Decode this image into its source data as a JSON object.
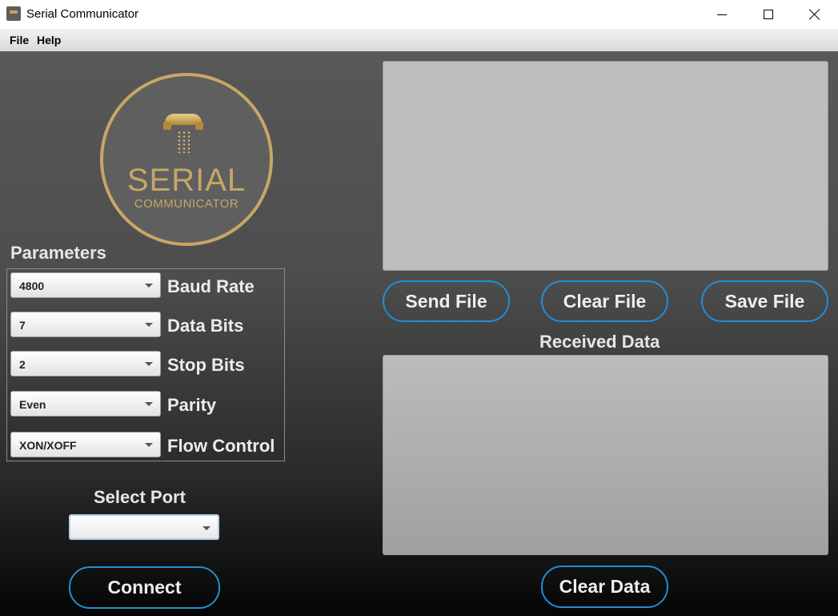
{
  "window": {
    "title": "Serial Communicator",
    "controls": [
      "minimize",
      "maximize",
      "close"
    ]
  },
  "menu": {
    "items": [
      "File",
      "Help"
    ]
  },
  "logo": {
    "line1": "SERIAL",
    "line2": "COMMUNICATOR",
    "icon": "telephone-handset-icon"
  },
  "parameters": {
    "label": "Parameters",
    "fields": [
      {
        "label": "Baud Rate",
        "value": "4800"
      },
      {
        "label": "Data Bits",
        "value": "7"
      },
      {
        "label": "Stop Bits",
        "value": "2"
      },
      {
        "label": "Parity",
        "value": "Even"
      },
      {
        "label": "Flow Control",
        "value": "XON/XOFF"
      }
    ]
  },
  "port": {
    "label": "Select Port",
    "value": ""
  },
  "buttons": {
    "connect": "Connect",
    "send_file": "Send File",
    "clear_file": "Clear File",
    "save_file": "Save File",
    "clear_data": "Clear Data"
  },
  "received": {
    "label": "Received Data"
  },
  "colors": {
    "accent": "#1f8fd6",
    "logo_gold": "#c7a765",
    "label_text": "#ececec"
  }
}
